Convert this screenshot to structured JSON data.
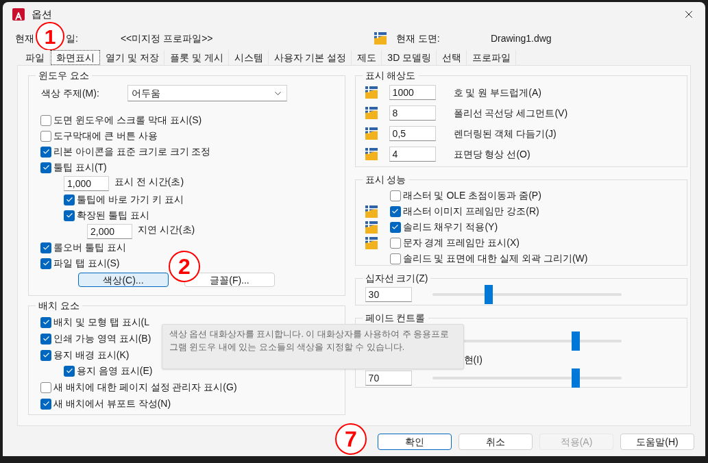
{
  "window": {
    "title": "옵션"
  },
  "profile": {
    "label_parts": [
      "현재",
      "일:"
    ],
    "value": "<<미지정 프로파일>>"
  },
  "drawing": {
    "label": "현재 도면:",
    "value": "Drawing1.dwg"
  },
  "tabs": [
    {
      "label": "파일",
      "selected": false
    },
    {
      "label": "화면표시",
      "selected": true
    },
    {
      "label": "열기 및 저장",
      "selected": false
    },
    {
      "label": "플롯 및 게시",
      "selected": false
    },
    {
      "label": "시스템",
      "selected": false
    },
    {
      "label": "사용자 기본 설정",
      "selected": false
    },
    {
      "label": "제도",
      "selected": false
    },
    {
      "label": "3D 모델링",
      "selected": false
    },
    {
      "label": "선택",
      "selected": false
    },
    {
      "label": "프로파일",
      "selected": false
    }
  ],
  "window_elements": {
    "title": "윈도우 요소",
    "color_theme": {
      "label": "색상 주제(M):",
      "value": "어두움"
    },
    "options": [
      {
        "kind": "checkbox",
        "label": "도면 윈도우에 스크롤 막대 표시(S)",
        "checked": false
      },
      {
        "kind": "checkbox",
        "label": "도구막대에 큰 버튼 사용",
        "checked": false
      },
      {
        "kind": "checkbox",
        "label": "리본 아이콘을 표준 크기로 크기 조정",
        "checked": true
      },
      {
        "kind": "checkbox",
        "label": "툴팁 표시(T)",
        "checked": true,
        "children": [
          {
            "kind": "number",
            "value": "1,000",
            "label": "표시 전 시간(초)"
          },
          {
            "kind": "checkbox",
            "label": "툴팁에 바로 가기 키 표시",
            "checked": true
          },
          {
            "kind": "checkbox",
            "label": "확장된 툴팁 표시",
            "checked": true,
            "children": [
              {
                "kind": "number",
                "value": "2,000",
                "label": "지연 시간(초)"
              }
            ]
          }
        ]
      },
      {
        "kind": "checkbox",
        "label": "롤오버 툴팁 표시",
        "checked": true
      },
      {
        "kind": "checkbox",
        "label": "파일 탭 표시(S)",
        "checked": true
      }
    ],
    "buttons": [
      {
        "label": "색상(C)...",
        "focused": true
      },
      {
        "label": "글꼴(F)...",
        "focused": false
      }
    ]
  },
  "layout_elements": {
    "title": "배치 요소",
    "options": [
      {
        "kind": "checkbox",
        "label": "배치 및 모형 탭 표시(L",
        "checked": true
      },
      {
        "kind": "checkbox",
        "label": "인쇄 가능 영역 표시(B)",
        "checked": true
      },
      {
        "kind": "checkbox",
        "label": "용지 배경 표시(K)",
        "checked": true,
        "children": [
          {
            "kind": "checkbox",
            "label": "용지 음영 표시(E)",
            "checked": true
          }
        ]
      },
      {
        "kind": "checkbox",
        "label": "새 배치에 대한 페이지 설정 관리자 표시(G)",
        "checked": false
      },
      {
        "kind": "checkbox",
        "label": "새 배치에서 뷰포트 작성(N)",
        "checked": true
      }
    ]
  },
  "display_resolution": {
    "title": "표시 해상도",
    "rows": [
      {
        "value": "1000",
        "label": "호 및 원 부드럽게(A)"
      },
      {
        "value": "8",
        "label": "폴리선 곡선당 세그먼트(V)"
      },
      {
        "value": "0,5",
        "label": "렌더링된 객체 다듬기(J)"
      },
      {
        "value": "4",
        "label": "표면당 형상 선(O)"
      }
    ]
  },
  "display_performance": {
    "title": "표시 성능",
    "options": [
      {
        "label": "래스터 및 OLE 초점이동과 줌(P)",
        "checked": false,
        "drawing_icon": false
      },
      {
        "label": "래스터 이미지 프레임만 강조(R)",
        "checked": true,
        "drawing_icon": true
      },
      {
        "label": "솔리드 채우기 적용(Y)",
        "checked": true,
        "drawing_icon": true
      },
      {
        "label": "문자 경계 프레임만 표시(X)",
        "checked": false,
        "drawing_icon": true
      },
      {
        "label": "솔리드 및 표면에 대한 실제 외곽 그리기(W)",
        "checked": false,
        "drawing_icon": false
      }
    ]
  },
  "crosshair": {
    "title": "십자선 크기(Z)",
    "value": "30",
    "level": 0.3
  },
  "fade_control": {
    "title": "페이드 컨트롤",
    "rows": [
      {
        "level": 0.76
      },
      {
        "label": "현(I)",
        "value": "70",
        "level": 0.76
      }
    ]
  },
  "tooltip": {
    "text": "색상 옵션 대화상자를 표시합니다. 이 대화상자를 사용하여 주 응용프로그램 윈도우 내에 있는 요소들의 색상을 지정할 수 있습니다."
  },
  "callouts": [
    "1",
    "2",
    "7"
  ],
  "footer_buttons": [
    {
      "label": "확인",
      "focused": true,
      "disabled": false
    },
    {
      "label": "취소",
      "focused": false,
      "disabled": false
    },
    {
      "label": "적용(A)",
      "focused": false,
      "disabled": true
    },
    {
      "label": "도움말(H)",
      "focused": false,
      "disabled": false
    }
  ]
}
